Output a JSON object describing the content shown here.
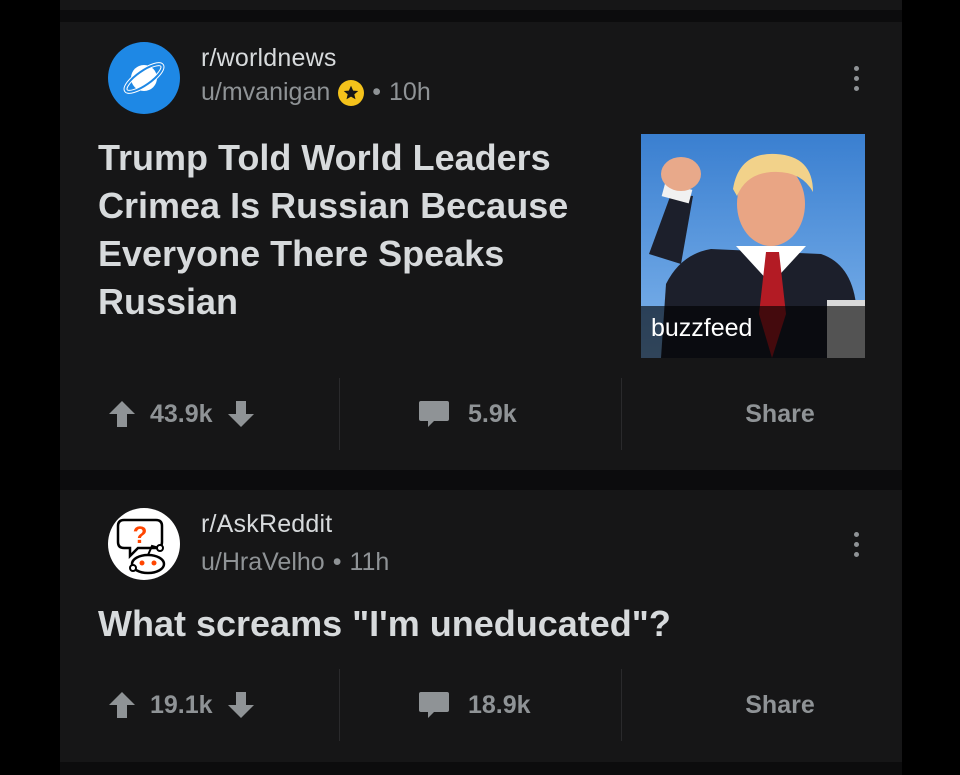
{
  "posts": [
    {
      "subreddit": "r/worldnews",
      "user": "u/mvanigan",
      "time": "10h",
      "has_award": true,
      "title": "Trump Told World Leaders Crimea Is Russian Because Everyone There Speaks Russian",
      "thumbnail_label": "buzzfeed",
      "upvotes": "43.9k",
      "comments": "5.9k",
      "share_label": "Share"
    },
    {
      "subreddit": "r/AskReddit",
      "user": "u/HraVelho",
      "time": "11h",
      "has_award": false,
      "title": "What screams \"I'm uneducated\"?",
      "upvotes": "19.1k",
      "comments": "18.9k",
      "share_label": "Share"
    }
  ],
  "meta_separator": "•",
  "colors": {
    "background": "#000000",
    "card": "#161617",
    "text_primary": "#d7dadc",
    "text_secondary": "#8f9396",
    "worldnews_avatar": "#1e88e5",
    "award": "#f4c21b",
    "askreddit_question": "#ff4500"
  },
  "icons": [
    "subreddit-planet-icon",
    "askreddit-alien-icon",
    "award-icon",
    "upvote-arrow-icon",
    "downvote-arrow-icon",
    "comment-bubble-icon",
    "more-options-icon"
  ]
}
